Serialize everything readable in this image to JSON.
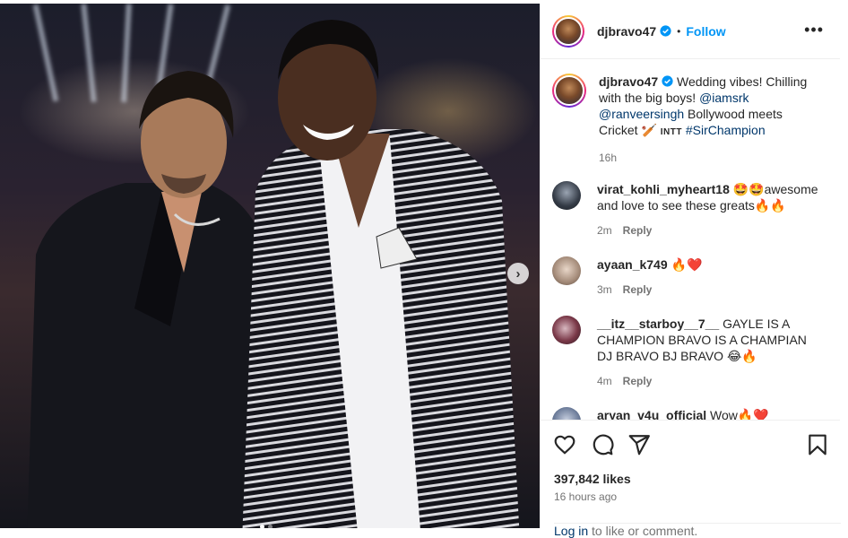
{
  "post": {
    "username": "djbravo47",
    "follow_label": "Follow",
    "bullet": "•",
    "more_label": "•••",
    "photo_alt": "",
    "carousel": {
      "dots": 2,
      "active": 0
    }
  },
  "caption": {
    "username": "djbravo47",
    "text_1": " Wedding vibes! Chilling with the big boys! ",
    "mention_1": "@iamsrk",
    "space": " ",
    "mention_2": "@ranveersingh",
    "text_2": " Bollywood meets Cricket 🏏 ",
    "intt": "INTT",
    "hashtag": "#SirChampion",
    "time": "16h"
  },
  "comments": [
    {
      "username": "virat_kohli_myheart18",
      "text": " 🤩🤩awesome and love to see these greats🔥🔥",
      "time": "2m",
      "reply_label": "Reply"
    },
    {
      "username": "ayaan_k749",
      "text": " 🔥❤️",
      "time": "3m",
      "reply_label": "Reply"
    },
    {
      "username": "__itz__starboy__7__",
      "text": " GAYLE IS A CHAMPION BRAVO IS A CHAMPIAN DJ BRAVO BJ BRAVO 😂🔥",
      "time": "4m",
      "reply_label": "Reply"
    },
    {
      "username": "aryan_v4u_official",
      "text": " Wow🔥❤️",
      "time": "",
      "reply_label": ""
    }
  ],
  "actions": {
    "likes": "397,842 likes",
    "posted_ago": "16 hours ago",
    "login_link": "Log in",
    "login_text": " to like or comment."
  },
  "colors": {
    "link": "#00376b",
    "follow": "#0095f6",
    "muted": "#737373"
  }
}
